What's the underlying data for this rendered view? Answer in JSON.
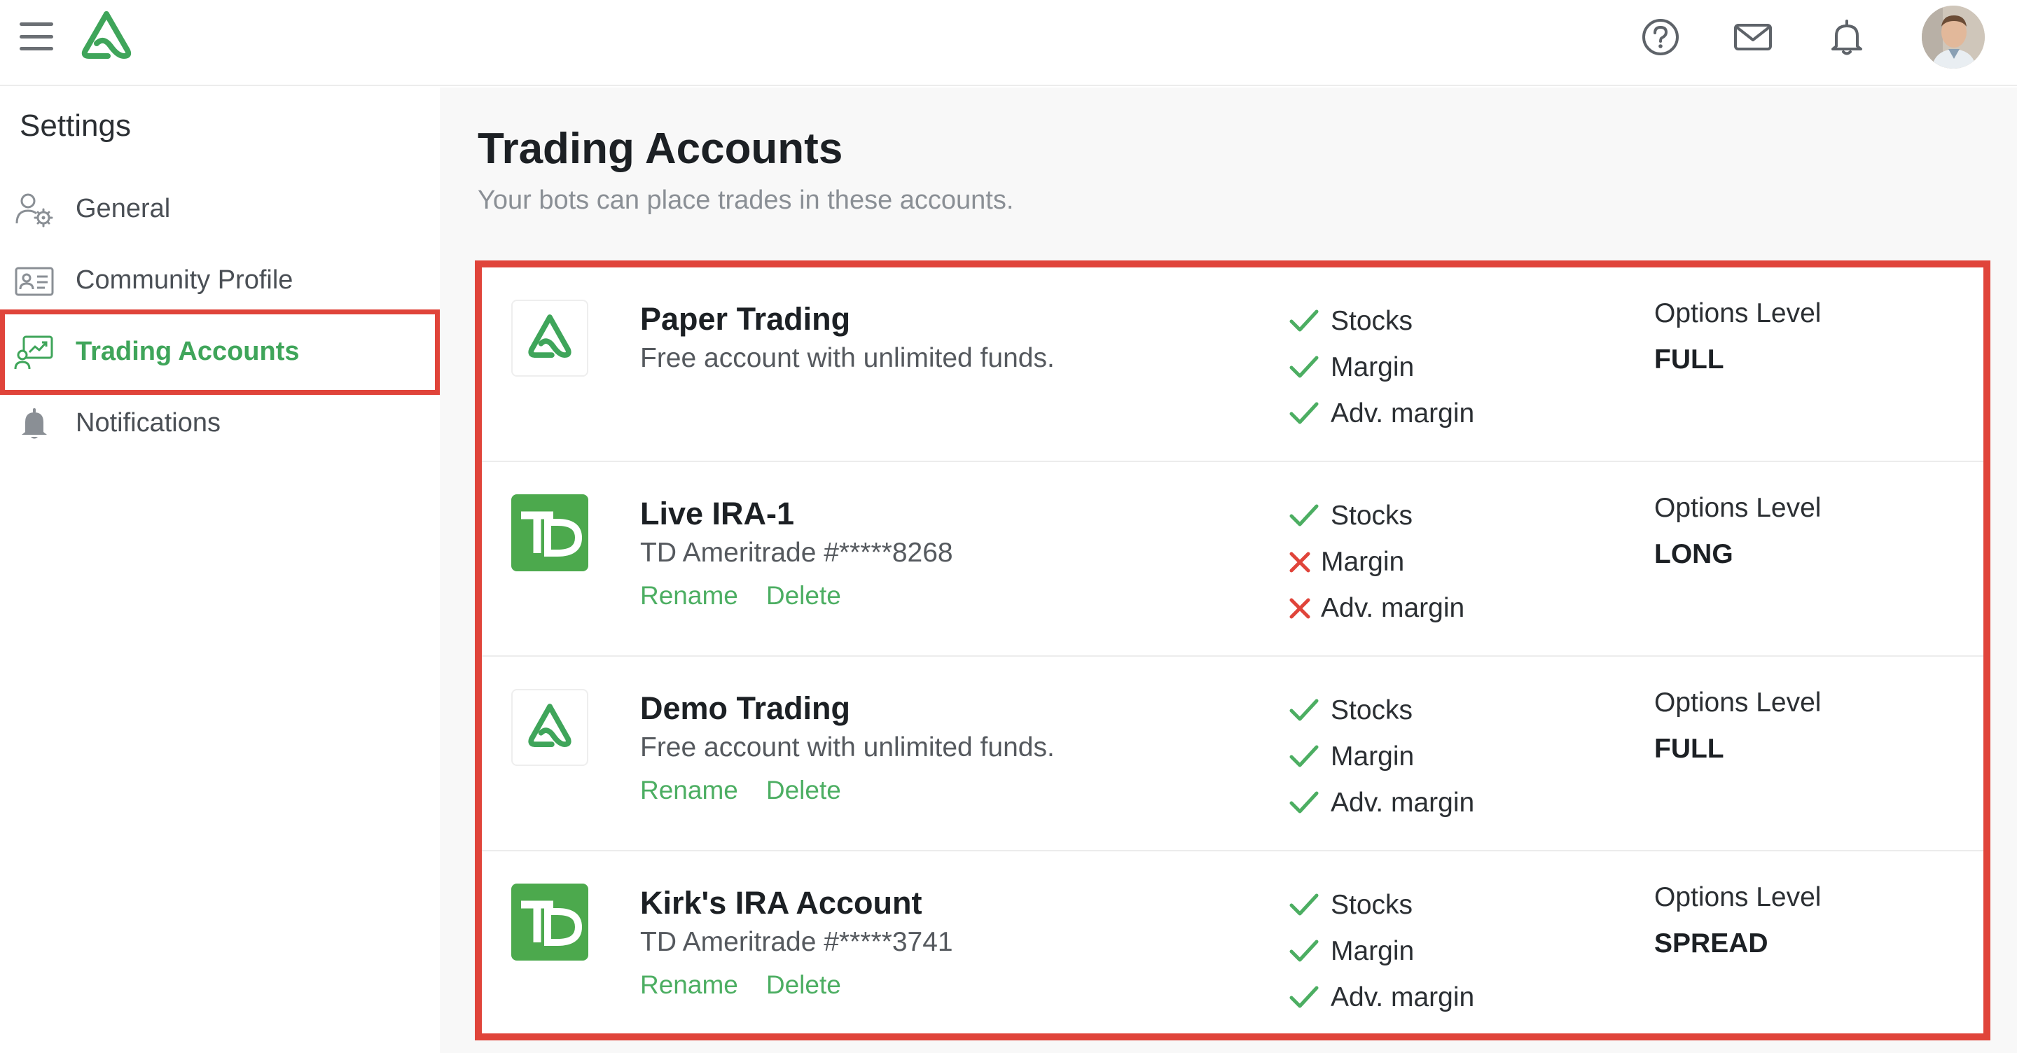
{
  "header": {
    "menu_icon": "hamburger-icon",
    "logo_icon": "brand-logo-icon",
    "help_icon": "help-circle-icon",
    "mail_icon": "mail-icon",
    "bell_icon": "bell-icon",
    "avatar_icon": "user-avatar"
  },
  "sidebar": {
    "title": "Settings",
    "items": [
      {
        "label": "General",
        "icon": "user-gear-icon",
        "active": false
      },
      {
        "label": "Community Profile",
        "icon": "id-card-icon",
        "active": false
      },
      {
        "label": "Trading Accounts",
        "icon": "trading-chart-icon",
        "active": true
      },
      {
        "label": "Notifications",
        "icon": "bell-icon",
        "active": false
      }
    ]
  },
  "main": {
    "title": "Trading Accounts",
    "subtitle": "Your bots can place trades in these accounts."
  },
  "accounts": [
    {
      "name": "Paper Trading",
      "description": "Free account with unlimited funds.",
      "logo": "brand-logo-icon",
      "actions": [],
      "features": [
        {
          "label": "Stocks",
          "enabled": true
        },
        {
          "label": "Margin",
          "enabled": true
        },
        {
          "label": "Adv. margin",
          "enabled": true
        }
      ],
      "options_title": "Options Level",
      "options_level": "FULL"
    },
    {
      "name": "Live IRA-1",
      "description": "TD Ameritrade #*****8268",
      "logo": "td-logo-icon",
      "actions": [
        "Rename",
        "Delete"
      ],
      "features": [
        {
          "label": "Stocks",
          "enabled": true
        },
        {
          "label": "Margin",
          "enabled": false
        },
        {
          "label": "Adv. margin",
          "enabled": false
        }
      ],
      "options_title": "Options Level",
      "options_level": "LONG"
    },
    {
      "name": "Demo Trading",
      "description": "Free account with unlimited funds.",
      "logo": "brand-logo-icon",
      "actions": [
        "Rename",
        "Delete"
      ],
      "features": [
        {
          "label": "Stocks",
          "enabled": true
        },
        {
          "label": "Margin",
          "enabled": true
        },
        {
          "label": "Adv. margin",
          "enabled": true
        }
      ],
      "options_title": "Options Level",
      "options_level": "FULL"
    },
    {
      "name": "Kirk's IRA Account",
      "description": "TD Ameritrade #*****3741",
      "logo": "td-logo-icon",
      "actions": [
        "Rename",
        "Delete"
      ],
      "features": [
        {
          "label": "Stocks",
          "enabled": true
        },
        {
          "label": "Margin",
          "enabled": true
        },
        {
          "label": "Adv. margin",
          "enabled": true
        }
      ],
      "options_title": "Options Level",
      "options_level": "SPREAD"
    }
  ],
  "colors": {
    "brand_green": "#3fa55a",
    "link_green": "#4cae62",
    "td_green": "#4ca94d",
    "error_red": "#e0443a",
    "highlight_red": "#e0443a"
  }
}
